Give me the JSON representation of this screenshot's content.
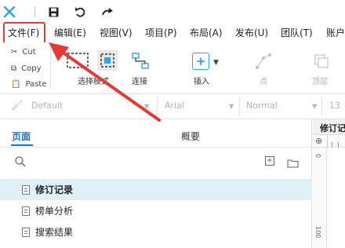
{
  "titlebar": {
    "app_logo": "axure-x-logo",
    "icons": [
      "save-icon",
      "undo-icon",
      "redo-icon"
    ]
  },
  "menu": {
    "items": [
      "文件(F)",
      "编辑(E)",
      "视图(V)",
      "项目(P)",
      "布局(A)",
      "发布(U)",
      "团队(T)",
      "账户"
    ]
  },
  "toolbar": {
    "clipboard": {
      "cut": "Cut",
      "copy": "Copy",
      "paste": "Paste"
    },
    "select_mode": "选择模式",
    "connect": "连接",
    "insert": "插入",
    "point": "点",
    "top_layer": "顶层"
  },
  "stylebar": {
    "style": "Default",
    "font": "Arial",
    "weight": "Normal",
    "size": "13"
  },
  "left_panel": {
    "tabs": {
      "pages": "页面",
      "outline": "概要"
    },
    "pages": [
      {
        "label": "修订记录",
        "active": true
      },
      {
        "label": "榜单分析",
        "active": false
      },
      {
        "label": "搜索结果",
        "active": false
      }
    ]
  },
  "right_panel": {
    "tab_label": "修订记录",
    "ruler_marks": [
      "0",
      "100"
    ]
  },
  "colors": {
    "accent": "#1a73c8",
    "logo": "#2ea8d8",
    "highlight": "#e53935",
    "selected_row": "#dff1f6"
  }
}
